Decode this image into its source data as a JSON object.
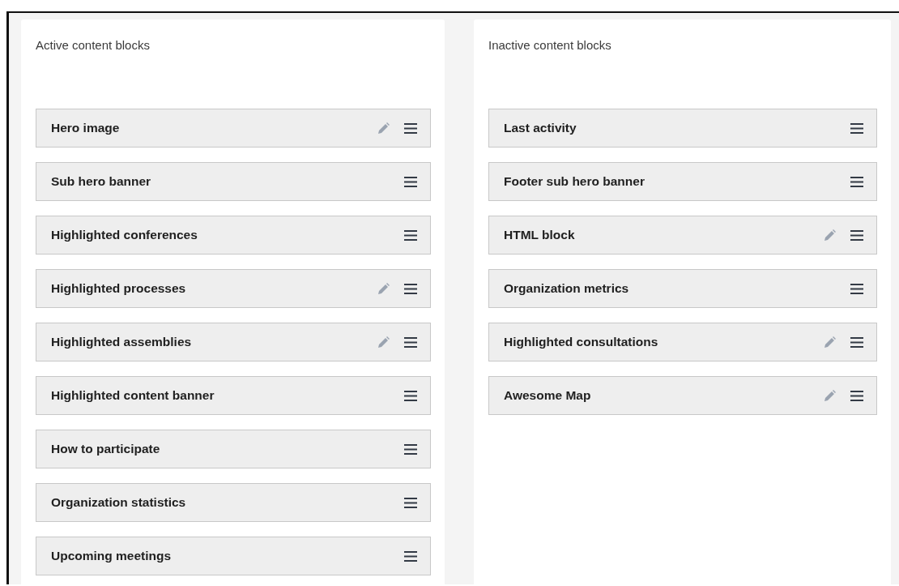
{
  "panels": [
    {
      "title": "Active content blocks",
      "blocks": [
        {
          "label": "Hero image",
          "editable": true
        },
        {
          "label": "Sub hero banner",
          "editable": false
        },
        {
          "label": "Highlighted conferences",
          "editable": false
        },
        {
          "label": "Highlighted processes",
          "editable": true
        },
        {
          "label": "Highlighted assemblies",
          "editable": true
        },
        {
          "label": "Highlighted content banner",
          "editable": false
        },
        {
          "label": "How to participate",
          "editable": false
        },
        {
          "label": "Organization statistics",
          "editable": false
        },
        {
          "label": "Upcoming meetings",
          "editable": false
        }
      ]
    },
    {
      "title": "Inactive content blocks",
      "blocks": [
        {
          "label": "Last activity",
          "editable": false
        },
        {
          "label": "Footer sub hero banner",
          "editable": false
        },
        {
          "label": "HTML block",
          "editable": true
        },
        {
          "label": "Organization metrics",
          "editable": false
        },
        {
          "label": "Highlighted consultations",
          "editable": true
        },
        {
          "label": "Awesome Map",
          "editable": true
        }
      ]
    }
  ]
}
